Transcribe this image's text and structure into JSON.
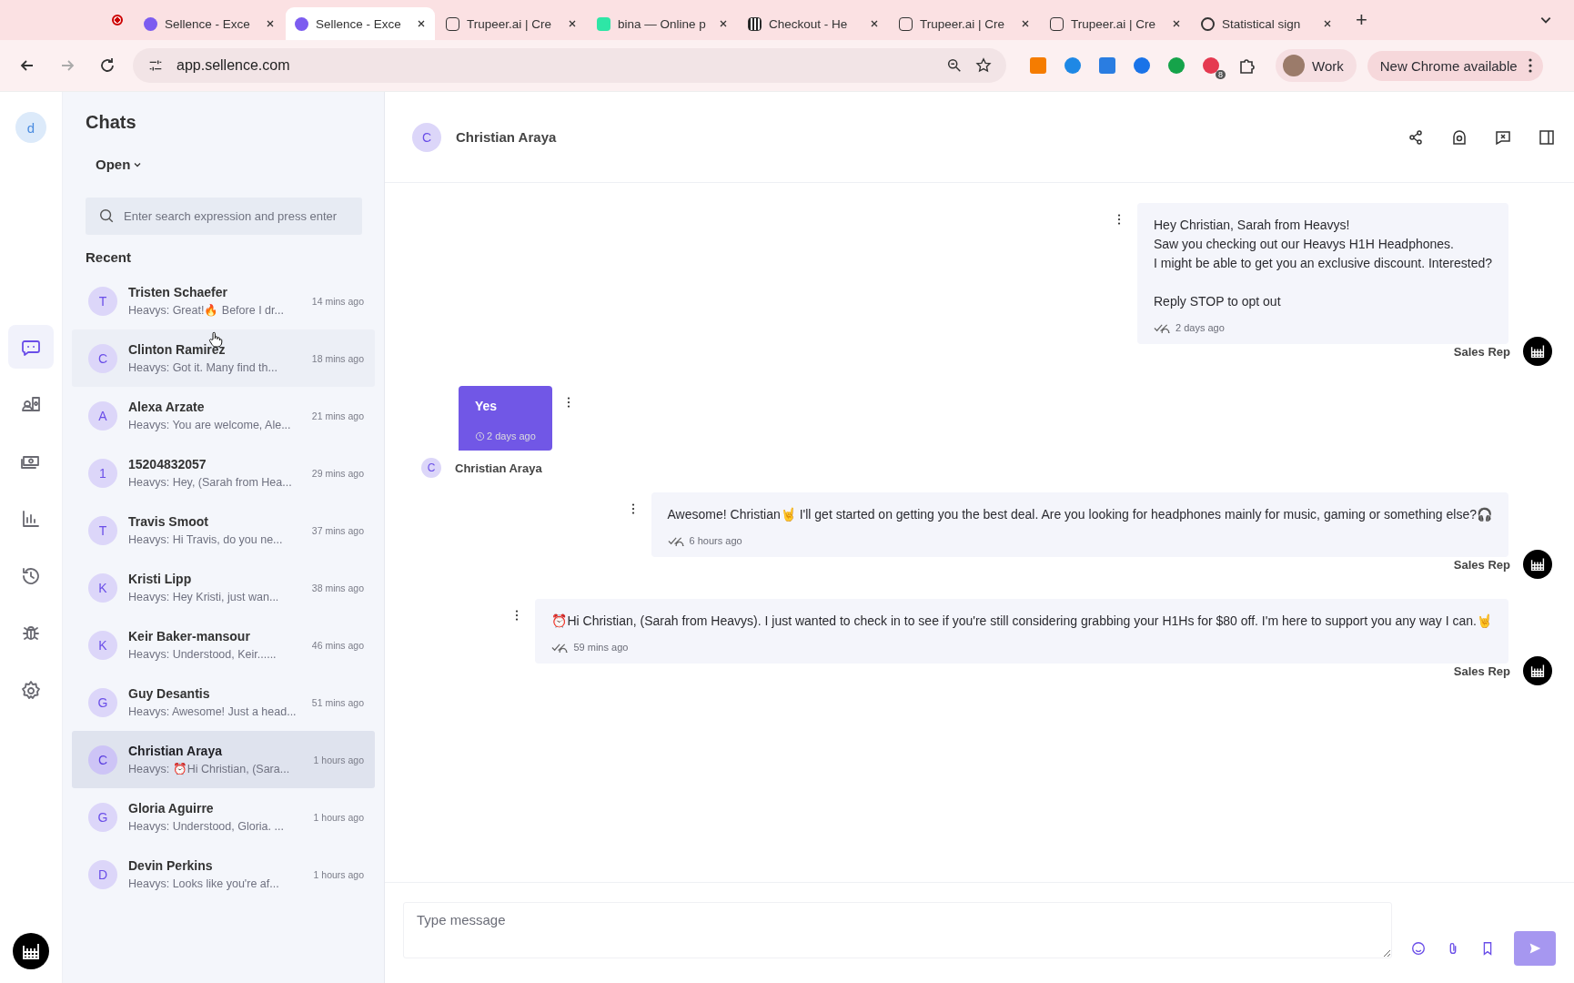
{
  "browser": {
    "tabs": [
      {
        "title": "Sellence - Exce",
        "selected": false,
        "kind": "sellence"
      },
      {
        "title": "Sellence - Exce",
        "selected": true,
        "kind": "sellence"
      },
      {
        "title": "Trupeer.ai | Cre",
        "selected": false,
        "kind": "trupeer"
      },
      {
        "title": "bina — Online p",
        "selected": false,
        "kind": "bina"
      },
      {
        "title": "Checkout - He",
        "selected": false,
        "kind": "checkout"
      },
      {
        "title": "Trupeer.ai | Cre",
        "selected": false,
        "kind": "trupeer"
      },
      {
        "title": "Trupeer.ai | Cre",
        "selected": false,
        "kind": "trupeer"
      },
      {
        "title": "Statistical sign",
        "selected": false,
        "kind": "openai"
      }
    ],
    "new_tab": "+",
    "url": "app.sellence.com",
    "extension_badge": "8",
    "profile": "Work",
    "update_button": "New Chrome available"
  },
  "rail": {
    "avatar": "d",
    "items": [
      {
        "selected": true
      },
      {
        "selected": false
      },
      {
        "selected": false
      },
      {
        "selected": false
      },
      {
        "selected": false
      },
      {
        "selected": false
      },
      {
        "selected": false
      }
    ]
  },
  "chats": {
    "title": "Chats",
    "filter": "Open",
    "search": {
      "placeholder": "Enter search expression and press enter"
    },
    "section": "Recent",
    "items": [
      {
        "initial": "T",
        "name": "Tristen Schaefer",
        "preview": "Heavys: Great!🔥 Before I dr...",
        "time": "14 mins ago",
        "selected": false,
        "hovered": false
      },
      {
        "initial": "C",
        "name": "Clinton Ramirez",
        "preview": "Heavys: Got it. Many find th...",
        "time": "18 mins ago",
        "selected": false,
        "hovered": true
      },
      {
        "initial": "A",
        "name": "Alexa Arzate",
        "preview": "Heavys: You are welcome, Ale...",
        "time": "21 mins ago",
        "selected": false,
        "hovered": false
      },
      {
        "initial": "1",
        "name": "15204832057",
        "preview": "Heavys: Hey, (Sarah from Hea...",
        "time": "29 mins ago",
        "selected": false,
        "hovered": false
      },
      {
        "initial": "T",
        "name": "Travis Smoot",
        "preview": "Heavys: Hi Travis, do you ne...",
        "time": "37 mins ago",
        "selected": false,
        "hovered": false
      },
      {
        "initial": "K",
        "name": "Kristi Lipp",
        "preview": "Heavys: Hey Kristi, just wan...",
        "time": "38 mins ago",
        "selected": false,
        "hovered": false
      },
      {
        "initial": "K",
        "name": "Keir Baker-mansour",
        "preview": "Heavys: Understood, Keir......",
        "time": "46 mins ago",
        "selected": false,
        "hovered": false
      },
      {
        "initial": "G",
        "name": "Guy Desantis",
        "preview": "Heavys: Awesome! Just a head...",
        "time": "51 mins ago",
        "selected": false,
        "hovered": false
      },
      {
        "initial": "C",
        "name": "Christian Araya",
        "preview": "Heavys: ⏰Hi Christian, (Sara...",
        "time": "1 hours ago",
        "selected": true,
        "hovered": false
      },
      {
        "initial": "G",
        "name": "Gloria Aguirre",
        "preview": "Heavys: Understood, Gloria. ...",
        "time": "1 hours ago",
        "selected": false,
        "hovered": false
      },
      {
        "initial": "D",
        "name": "Devin Perkins",
        "preview": "Heavys: Looks like you're af...",
        "time": "1 hours ago",
        "selected": false,
        "hovered": false
      }
    ]
  },
  "conversation": {
    "initial": "C",
    "name": "Christian Araya",
    "messages": [
      {
        "kind": "outgoing",
        "lines": [
          "Hey Christian, Sarah from Heavys!\nSaw you checking out our Heavys H1H Headphones.\nI might be able to get you an exclusive discount. Interested?",
          "Reply STOP to opt out"
        ],
        "time": "2 days ago",
        "sender": "Sales Rep"
      },
      {
        "kind": "incoming",
        "lines": [
          "Yes"
        ],
        "time": "2 days ago",
        "sender": "Christian Araya",
        "initial": "C"
      },
      {
        "kind": "outgoing",
        "lines": [
          "Awesome! Christian🤘 I'll get started on getting you the best deal. Are you looking for headphones mainly for music, gaming or something else?🎧"
        ],
        "time": "6 hours ago",
        "sender": "Sales Rep"
      },
      {
        "kind": "outgoing",
        "lines": [
          "⏰Hi Christian, (Sarah from Heavys). I just wanted to check in to see if you're still considering grabbing your H1Hs for $80 off. I'm here to support you any way I can.🤘"
        ],
        "time": "59 mins ago",
        "sender": "Sales Rep"
      }
    ],
    "composer": {
      "placeholder": "Type message"
    }
  }
}
